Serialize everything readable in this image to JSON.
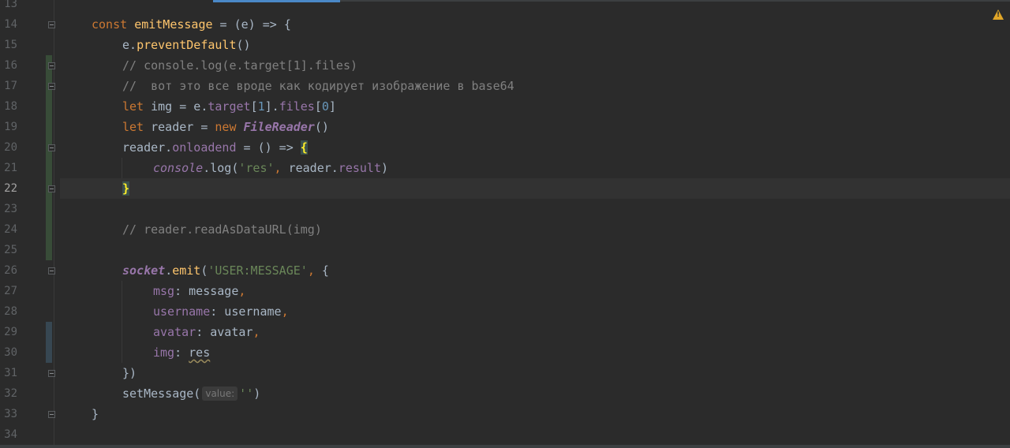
{
  "editor": {
    "current_line": 22,
    "line_numbers": [
      "13",
      "14",
      "15",
      "16",
      "17",
      "18",
      "19",
      "20",
      "21",
      "22",
      "23",
      "24",
      "25",
      "26",
      "27",
      "28",
      "29",
      "30",
      "31",
      "32",
      "33",
      "34"
    ],
    "warning_icon": "warning-icon",
    "colors": {
      "keyword": "#cc7832",
      "function": "#ffc66d",
      "comment": "#808080",
      "string": "#6a8759",
      "number": "#6897bb",
      "property": "#9876aa",
      "text": "#a9b7c6"
    }
  },
  "code": {
    "l14": {
      "kw": "const",
      "name": "emitMessage",
      "rest": " = (e) => {"
    },
    "l15": {
      "obj": "e.",
      "fn": "preventDefault",
      "rest": "()"
    },
    "l16": {
      "comment": "// console.log(e.target[1].files)"
    },
    "l17": {
      "comment": "//  вот это все вроде как кодирует изображение в base64"
    },
    "l18": {
      "kw": "let",
      "a": " img = e.",
      "prop1": "target",
      "b": "[",
      "n1": "1",
      "c": "].",
      "prop2": "files",
      "d": "[",
      "n2": "0",
      "e": "]"
    },
    "l19": {
      "kw": "let",
      "a": " reader = ",
      "kw2": "new",
      "sp": " ",
      "cls": "FileReader",
      "b": "()"
    },
    "l20": {
      "a": "reader.",
      "prop": "onloadend",
      "b": " = () => ",
      "brace": "{"
    },
    "l21": {
      "obj": "console",
      "dot": ".",
      "fn": "log",
      "a": "(",
      "str": "'res'",
      "comma": ",",
      "b": " reader.",
      "prop": "result",
      "c": ")"
    },
    "l22": {
      "brace": "}"
    },
    "l24": {
      "comment": "// reader.readAsDataURL(img)"
    },
    "l26": {
      "obj": "socket",
      "dot": ".",
      "fn": "emit",
      "a": "(",
      "str": "'USER:MESSAGE'",
      "comma": ",",
      "b": " {"
    },
    "l27": {
      "key": "msg",
      "a": ": message",
      "comma": ","
    },
    "l28": {
      "key": "username",
      "a": ": username",
      "comma": ","
    },
    "l29": {
      "key": "avatar",
      "a": ": avatar",
      "comma": ","
    },
    "l30": {
      "key": "img",
      "a": ": ",
      "val": "res"
    },
    "l31": {
      "text": "})"
    },
    "l32": {
      "fn": "setMessage(",
      "hint": "value:",
      "str": "''",
      "b": ")"
    },
    "l33": {
      "text": "}"
    }
  }
}
